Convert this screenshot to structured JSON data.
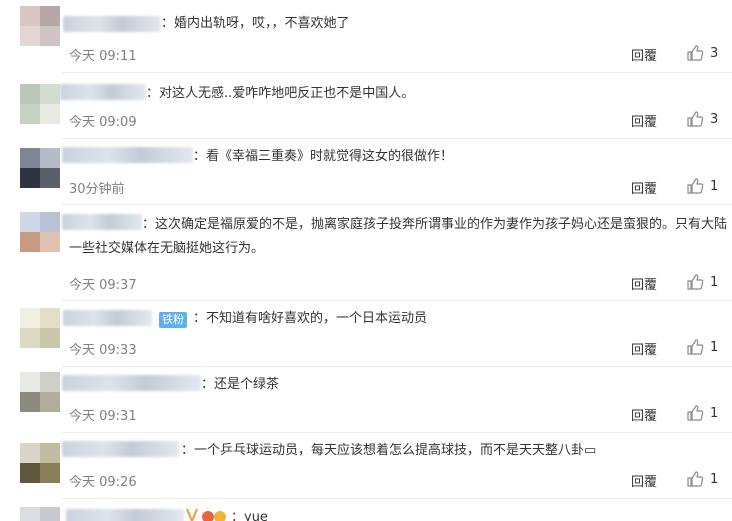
{
  "actions": {
    "reply_label": "回覆"
  },
  "comments": [
    {
      "text": "：婚内出轨呀，哎，，不喜欢她了",
      "time": "今天 09:11",
      "likes": "3",
      "avatar": [
        "#d9c6c4",
        "#b7a7a9",
        "#e4d6d3",
        "#cfc3c6"
      ]
    },
    {
      "text": "：对这人无感..爱咋咋地吧反正也不是中国人。",
      "time": "今天 09:09",
      "likes": "3",
      "avatar": [
        "#b9c8ba",
        "#d3ddd2",
        "#c7d1c4",
        "#e6ece4"
      ]
    },
    {
      "text": "：看《幸福三重奏》时就觉得这女的很做作！",
      "time": "30分钟前",
      "likes": "1",
      "avatar": [
        "#7d8696",
        "#b5bcc7",
        "#2f3440",
        "#5b5f6c"
      ]
    },
    {
      "text": "：这次确定是福原爱的不是，抛离家庭孩子投奔所谓事业的作为妻作为孩子妈心还是蛮狠的。只有大陆一些社交媒体在无脑挺她这行为。",
      "time": "今天 09:37",
      "likes": "1",
      "avatar": [
        "#cfd6e6",
        "#b8c1d6",
        "#c79a82",
        "#e0c3b3"
      ]
    },
    {
      "text": "：不知道有啥好喜欢的，一个日本运动员",
      "time": "今天 09:33",
      "likes": "1",
      "badge": "铁粉",
      "avatar": [
        "#f1efe0",
        "#e2dfc6",
        "#dcd9c4",
        "#c9c6ad"
      ]
    },
    {
      "text": "：还是个绿茶",
      "time": "今天 09:31",
      "likes": "1",
      "avatar": [
        "#e9e9e6",
        "#cfcfc9",
        "#8d8a80",
        "#b2ae9e"
      ]
    },
    {
      "text": "：一个乒乓球运动员，每天应该想着怎么提高球技，而不是天天整八卦▭",
      "time": "今天 09:26",
      "likes": "1",
      "avatar": [
        "#d8d4c8",
        "#c2bba2",
        "#5f573c",
        "#8b7f5a"
      ]
    },
    {
      "text": "：yue",
      "time": "",
      "likes": "",
      "avatar": [
        "#dcdde3",
        "#c8cad3",
        "#eeeeee",
        "#e2e2e2"
      ]
    }
  ]
}
